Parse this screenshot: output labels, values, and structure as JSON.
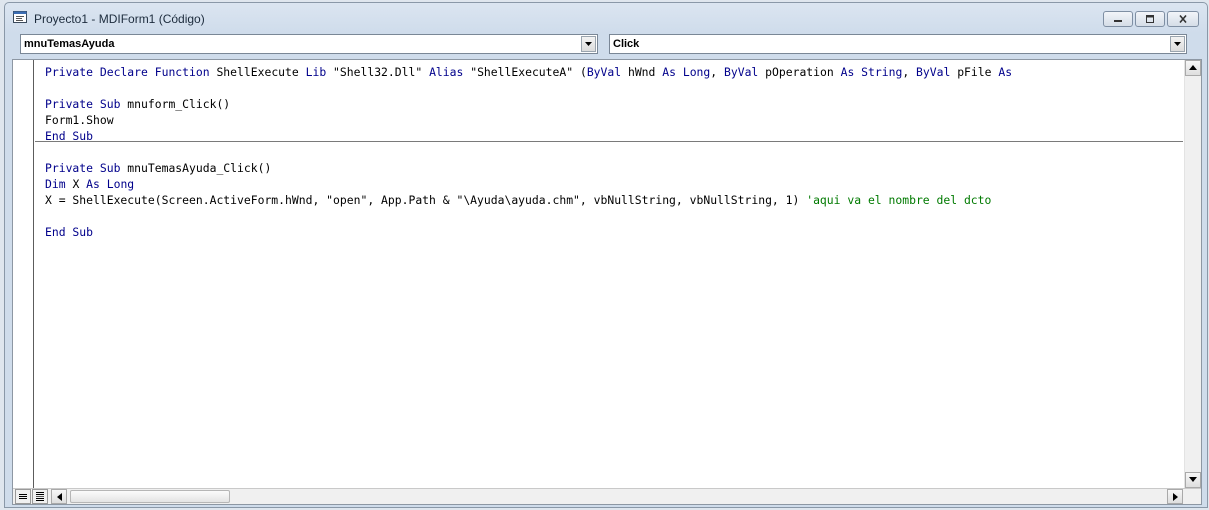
{
  "window": {
    "title": "Proyecto1 - MDIForm1 (Código)"
  },
  "object_combo": {
    "value": "mnuTemasAyuda"
  },
  "procedure_combo": {
    "value": "Click"
  },
  "code": {
    "lines": [
      {
        "row": 0,
        "tokens": [
          {
            "t": "Private Declare Function ",
            "k": "kw"
          },
          {
            "t": "ShellExecute ",
            "k": "tx"
          },
          {
            "t": "Lib ",
            "k": "kw"
          },
          {
            "t": "\"Shell32.Dll\" ",
            "k": "tx"
          },
          {
            "t": "Alias ",
            "k": "kw"
          },
          {
            "t": "\"ShellExecuteA\" (",
            "k": "tx"
          },
          {
            "t": "ByVal ",
            "k": "kw"
          },
          {
            "t": "hWnd ",
            "k": "tx"
          },
          {
            "t": "As Long",
            "k": "kw"
          },
          {
            "t": ", ",
            "k": "tx"
          },
          {
            "t": "ByVal ",
            "k": "kw"
          },
          {
            "t": "pOperation ",
            "k": "tx"
          },
          {
            "t": "As String",
            "k": "kw"
          },
          {
            "t": ", ",
            "k": "tx"
          },
          {
            "t": "ByVal ",
            "k": "kw"
          },
          {
            "t": "pFile ",
            "k": "tx"
          },
          {
            "t": "As ",
            "k": "kw"
          }
        ]
      },
      {
        "row": 2,
        "tokens": [
          {
            "t": "Private Sub ",
            "k": "kw"
          },
          {
            "t": "mnuform_Click()",
            "k": "tx"
          }
        ]
      },
      {
        "row": 3,
        "tokens": [
          {
            "t": "Form1.Show",
            "k": "tx"
          }
        ]
      },
      {
        "row": 4,
        "tokens": [
          {
            "t": "End Sub",
            "k": "kw"
          }
        ]
      },
      {
        "row": 6,
        "tokens": [
          {
            "t": "Private Sub ",
            "k": "kw"
          },
          {
            "t": "mnuTemasAyuda_Click()",
            "k": "tx"
          }
        ]
      },
      {
        "row": 7,
        "tokens": [
          {
            "t": "Dim ",
            "k": "kw"
          },
          {
            "t": "X ",
            "k": "tx"
          },
          {
            "t": "As Long",
            "k": "kw"
          }
        ]
      },
      {
        "row": 8,
        "tokens": [
          {
            "t": "X = ShellExecute(Screen.ActiveForm.hWnd, \"open\", App.Path & \"\\Ayuda\\ayuda.chm\", vbNullString, vbNullString, 1) ",
            "k": "tx"
          },
          {
            "t": "'aqui va el nombre del dcto",
            "k": "cm"
          }
        ]
      },
      {
        "row": 10,
        "tokens": [
          {
            "t": "End Sub",
            "k": "kw"
          }
        ]
      }
    ],
    "separator_rows": [
      5
    ]
  },
  "colors": {
    "keyword": "#00008b",
    "comment": "#007a00",
    "text": "#000000"
  },
  "icons": {
    "title": "vb-code-window-icon",
    "minimize": "minimize-icon",
    "restore": "restore-icon",
    "close": "close-icon",
    "dropdown": "chevron-down-icon",
    "scroll_up": "arrow-up-icon",
    "scroll_down": "arrow-down-icon",
    "scroll_left": "arrow-left-icon",
    "scroll_right": "arrow-right-icon",
    "procedure_view": "procedure-view-icon",
    "full_module_view": "full-module-view-icon"
  }
}
